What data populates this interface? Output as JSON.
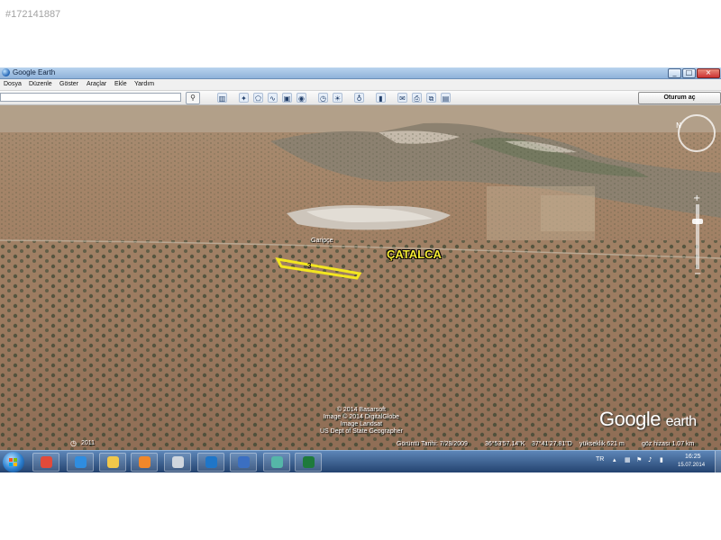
{
  "listing_id": "#172141887",
  "window": {
    "title": "Google Earth",
    "controls": {
      "minimize": "_",
      "maximize": "□",
      "close": "×"
    }
  },
  "menu": [
    "Dosya",
    "Düzenle",
    "Göster",
    "Araçlar",
    "Ekle",
    "Yardım"
  ],
  "toolbar": {
    "search_value": "",
    "search_icon": "magnifier-icon",
    "signin_label": "Oturum aç"
  },
  "map": {
    "place_label": "ÇATALCA",
    "small_place_label": "Garipçe",
    "parcel_number": "3",
    "copyright_lines": [
      "© 2014 Basarsoft",
      "Image © 2014 DigitalGlobe",
      "Image Landsat",
      "US Dept of State Geographer"
    ],
    "brand": {
      "word1": "Google",
      "word2": "earth"
    },
    "historical_year": "2011",
    "status": {
      "date": "Görüntü Tarihi: 7/29/2009",
      "lat": "36°53'57.14\"K",
      "lon": "37°41'27.81\"D",
      "elevation": "yükseklik   621 m",
      "eye": "göz hizası  1.07 km"
    },
    "colors": {
      "label": "#f5ea34",
      "parcel": "#f3e620"
    }
  },
  "taskbar": {
    "apps": [
      {
        "name": "chrome-icon",
        "color": "#e24a3a"
      },
      {
        "name": "internet-explorer-icon",
        "color": "#2f8de0"
      },
      {
        "name": "explorer-folder-icon",
        "color": "#f1c74a"
      },
      {
        "name": "media-player-icon",
        "color": "#f0872a"
      },
      {
        "name": "calculator-icon",
        "color": "#cfd6de"
      },
      {
        "name": "teamviewer-icon",
        "color": "#1f76c8"
      },
      {
        "name": "google-earth-icon",
        "color": "#3b6fc2"
      },
      {
        "name": "netgis-icon",
        "color": "#55b6a8"
      },
      {
        "name": "excel-icon",
        "color": "#1e7a3b"
      }
    ],
    "language": "TR",
    "time": "16:25",
    "date": "15.07.2014"
  }
}
